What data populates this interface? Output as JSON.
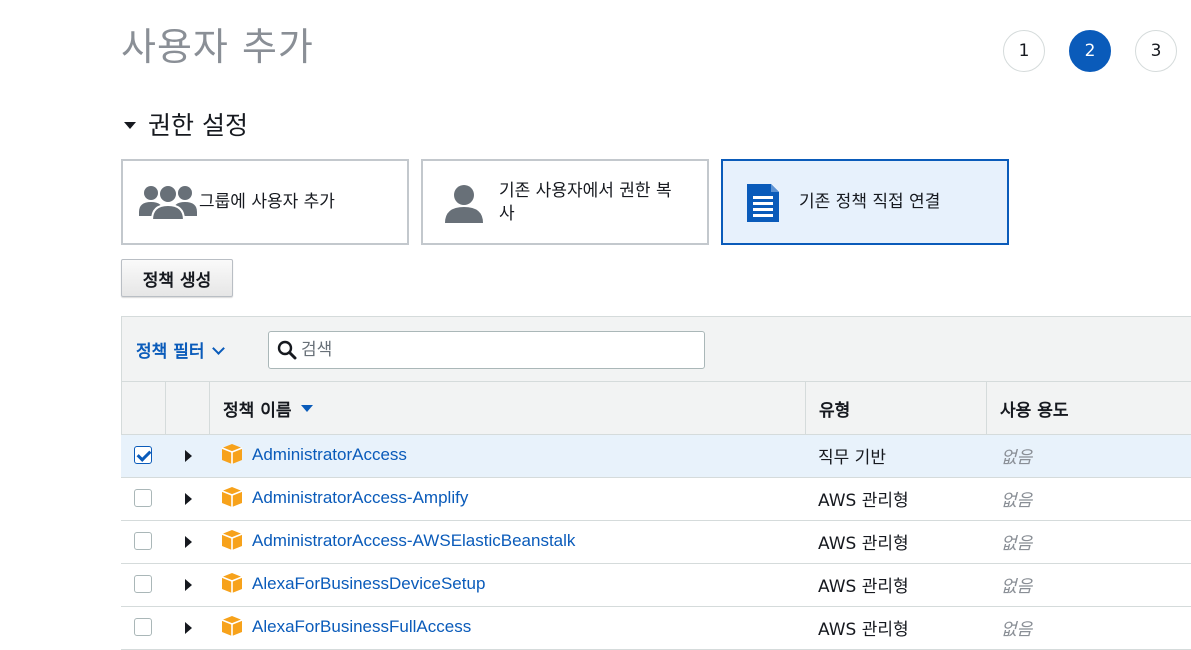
{
  "page_title": "사용자 추가",
  "steps": [
    {
      "label": "1",
      "active": false
    },
    {
      "label": "2",
      "active": true
    },
    {
      "label": "3",
      "active": false
    }
  ],
  "permissions": {
    "section_title": "권한 설정",
    "options": [
      {
        "label": "그룹에 사용자 추가",
        "icon": "group-users-icon",
        "selected": false
      },
      {
        "label_line1": "기존 사용자에서 권한 복",
        "label_line2": "사",
        "icon": "user-icon",
        "selected": false
      },
      {
        "label": "기존 정책 직접 연결",
        "icon": "document-icon",
        "selected": true
      }
    ],
    "create_policy_button": "정책 생성"
  },
  "filter": {
    "dropdown_label": "정책 필터",
    "search_placeholder": "검색"
  },
  "table": {
    "columns": {
      "name": "정책 이름",
      "type": "유형",
      "usage": "사용 용도"
    },
    "rows": [
      {
        "name": "AdministratorAccess",
        "type": "직무 기반",
        "usage": "없음",
        "checked": true
      },
      {
        "name": "AdministratorAccess-Amplify",
        "type": "AWS 관리형",
        "usage": "없음",
        "checked": false
      },
      {
        "name": "AdministratorAccess-AWSElasticBeanstalk",
        "type": "AWS 관리형",
        "usage": "없음",
        "checked": false
      },
      {
        "name": "AlexaForBusinessDeviceSetup",
        "type": "AWS 관리형",
        "usage": "없음",
        "checked": false
      },
      {
        "name": "AlexaForBusinessFullAccess",
        "type": "AWS 관리형",
        "usage": "없음",
        "checked": false
      }
    ]
  },
  "colors": {
    "accent": "#0a5bba",
    "policy_icon": "#f7a21b",
    "selected_row": "#e8f2fb"
  }
}
